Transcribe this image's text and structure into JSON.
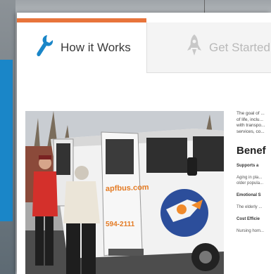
{
  "tabs": [
    {
      "label": "How it Works",
      "active": true,
      "icon": "wrench-icon"
    },
    {
      "label": "Get Started",
      "active": false,
      "icon": "rocket-icon"
    }
  ],
  "colors": {
    "accent": "#e8743b",
    "icon_active": "#1a86c8",
    "icon_inactive": "#c8c8c8"
  },
  "photo": {
    "van_text_1": "apfbus.com",
    "van_text_2": "594-2111"
  },
  "content": {
    "intro_lines": [
      "The goal of ...",
      "of life, inclu...",
      "with transpo...",
      "services, co..."
    ],
    "benefits_title": "Benef",
    "sections": [
      {
        "heading": "Supports a",
        "text": [
          "Aging in pla...",
          "older popula..."
        ]
      },
      {
        "heading": "Emotional S",
        "text": [
          "The elderly ..."
        ]
      },
      {
        "heading": "Cost Efficie",
        "text": [
          "Nursing hom..."
        ]
      }
    ]
  }
}
